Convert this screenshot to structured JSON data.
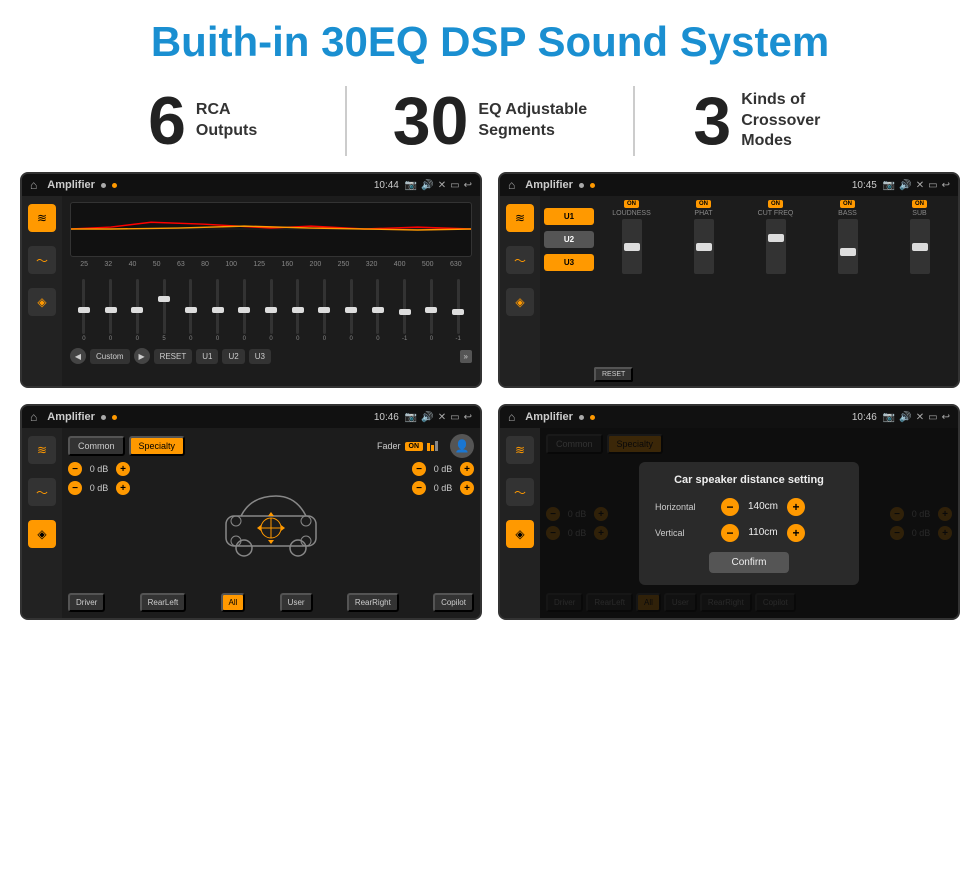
{
  "header": {
    "title": "Buith-in 30EQ DSP Sound System"
  },
  "stats": [
    {
      "number": "6",
      "label": "RCA\nOutputs"
    },
    {
      "number": "30",
      "label": "EQ Adjustable\nSegments"
    },
    {
      "number": "3",
      "label": "Kinds of\nCrossover Modes"
    }
  ],
  "screen1": {
    "app_name": "Amplifier",
    "time": "10:44",
    "eq_frequencies": [
      "25",
      "32",
      "40",
      "50",
      "63",
      "80",
      "100",
      "125",
      "160",
      "200",
      "250",
      "320",
      "400",
      "500",
      "630"
    ],
    "eq_values": [
      "0",
      "0",
      "0",
      "5",
      "0",
      "0",
      "0",
      "0",
      "0",
      "0",
      "0",
      "0",
      "-1",
      "0",
      "-1"
    ],
    "preset": "Custom",
    "buttons": [
      "RESET",
      "U1",
      "U2",
      "U3"
    ]
  },
  "screen2": {
    "app_name": "Amplifier",
    "time": "10:45",
    "presets": [
      "U1",
      "U2",
      "U3"
    ],
    "sections": [
      "LOUDNESS",
      "PHAT",
      "CUT FREQ",
      "BASS",
      "SUB"
    ],
    "on_badges": [
      "ON",
      "ON",
      "ON",
      "ON",
      "ON"
    ],
    "reset_label": "RESET"
  },
  "screen3": {
    "app_name": "Amplifier",
    "time": "10:46",
    "tabs": [
      "Common",
      "Specialty"
    ],
    "fader_label": "Fader",
    "fader_on": "ON",
    "db_values": [
      "0 dB",
      "0 dB",
      "0 dB",
      "0 dB"
    ],
    "bottom_buttons": [
      "Driver",
      "RearLeft",
      "All",
      "User",
      "RearRight",
      "Copilot"
    ]
  },
  "screen4": {
    "app_name": "Amplifier",
    "time": "10:46",
    "tabs": [
      "Common",
      "Specialty"
    ],
    "dialog": {
      "title": "Car speaker distance setting",
      "horizontal_label": "Horizontal",
      "horizontal_value": "140cm",
      "vertical_label": "Vertical",
      "vertical_value": "110cm",
      "confirm_label": "Confirm"
    },
    "bottom_buttons": [
      "Driver",
      "RearLeft",
      "All",
      "User",
      "RearRight",
      "Copilot"
    ]
  }
}
